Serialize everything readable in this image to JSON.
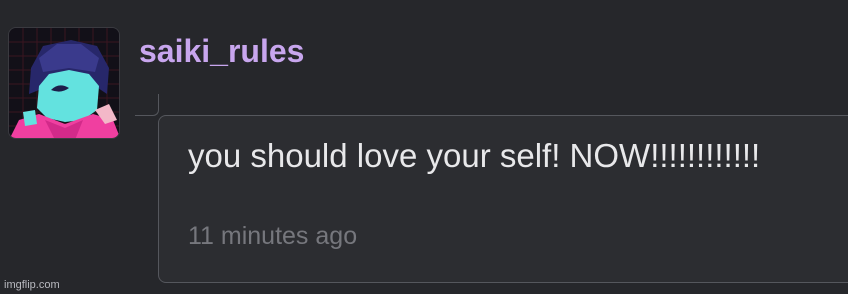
{
  "post": {
    "username": "saiki_rules",
    "message": "you should love your self! NOW!!!!!!!!!!!!",
    "timestamp": "11 minutes ago"
  },
  "watermark": "imgflip.com",
  "colors": {
    "background": "#26272b",
    "username": "#c8a6ee",
    "bubble_background": "#2c2d31",
    "bubble_border": "#55575d",
    "message_text": "#e8e8ea",
    "timestamp_text": "#76777d"
  },
  "avatar": {
    "icon": "pixel-character-avatar-icon"
  }
}
